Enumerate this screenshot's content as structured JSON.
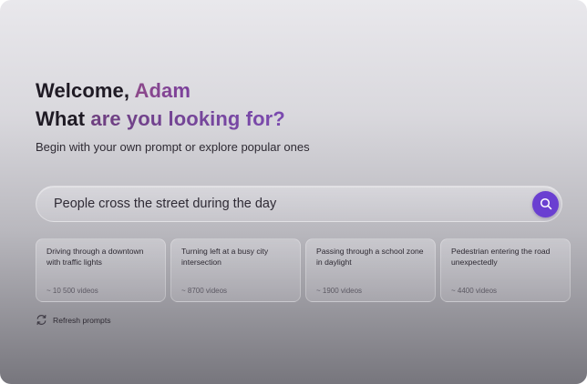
{
  "welcome": {
    "greeting": "Welcome, ",
    "name": "Adam",
    "question_prefix": "What ",
    "question_highlight": "are you looking for?"
  },
  "subtitle": "Begin with your own prompt or explore popular ones",
  "search": {
    "value": "People cross the street during the day",
    "button_icon": "search-icon"
  },
  "prompts": [
    {
      "title": "Driving through a downtown with traffic lights",
      "count": "~ 10 500 videos"
    },
    {
      "title": "Turning left at a busy city intersection",
      "count": "~ 8700 videos"
    },
    {
      "title": "Passing through a school zone in daylight",
      "count": "~ 1900 videos"
    },
    {
      "title": "Pedestrian entering the road unexpectedly",
      "count": "~ 4400 videos"
    }
  ],
  "refresh": {
    "label": "Refresh prompts",
    "icon": "refresh-icon"
  },
  "colors": {
    "accent": "#6a3fd1",
    "heading_dark": "#1f1a24",
    "heading_gradient_start": "#8d4a8a",
    "heading_gradient_end": "#7a3f9c"
  }
}
